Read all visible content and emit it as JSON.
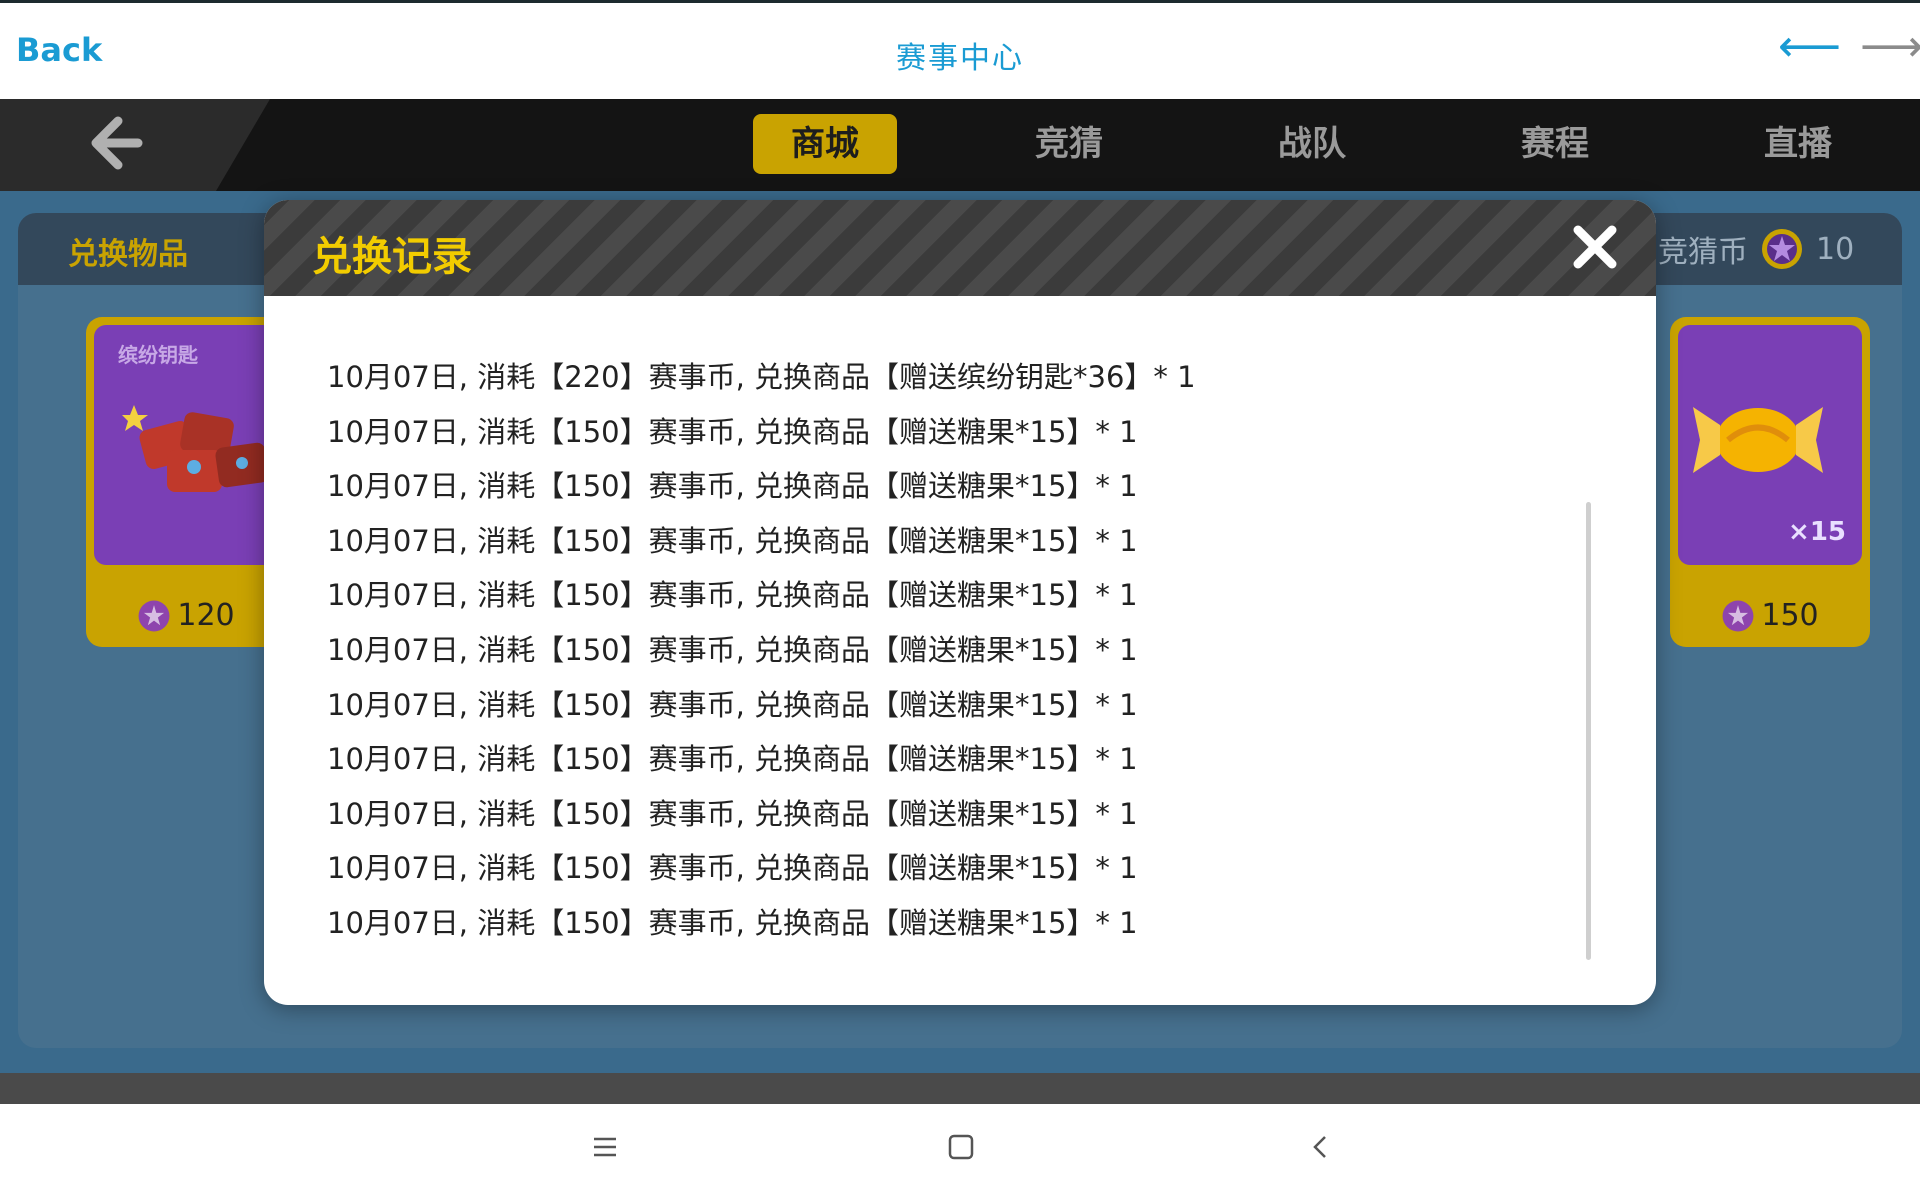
{
  "browser": {
    "back_label": "Back",
    "title": "赛事中心",
    "nav_back_glyph": "⟵",
    "nav_forward_glyph": "⟶"
  },
  "game_nav": {
    "tabs": [
      {
        "label": "商城",
        "active": true
      },
      {
        "label": "竞猜",
        "active": false
      },
      {
        "label": "战队",
        "active": false
      },
      {
        "label": "赛程",
        "active": false
      },
      {
        "label": "直播",
        "active": false
      }
    ]
  },
  "shop": {
    "header_label": "兑换物品",
    "coin_label": "竞猜币",
    "coin_value": "10",
    "cards": [
      {
        "label": "缤纷钥匙",
        "price": "120",
        "qty": ""
      },
      {
        "label": "",
        "price": "150",
        "qty": "×15"
      }
    ]
  },
  "modal": {
    "title": "兑换记录",
    "records": [
      "10月07日, 消耗【220】赛事币, 兑换商品【赠送缤纷钥匙*36】* 1",
      "10月07日, 消耗【150】赛事币, 兑换商品【赠送糖果*15】* 1",
      "10月07日, 消耗【150】赛事币, 兑换商品【赠送糖果*15】* 1",
      "10月07日, 消耗【150】赛事币, 兑换商品【赠送糖果*15】* 1",
      "10月07日, 消耗【150】赛事币, 兑换商品【赠送糖果*15】* 1",
      "10月07日, 消耗【150】赛事币, 兑换商品【赠送糖果*15】* 1",
      "10月07日, 消耗【150】赛事币, 兑换商品【赠送糖果*15】* 1",
      "10月07日, 消耗【150】赛事币, 兑换商品【赠送糖果*15】* 1",
      "10月07日, 消耗【150】赛事币, 兑换商品【赠送糖果*15】* 1",
      "10月07日, 消耗【150】赛事币, 兑换商品【赠送糖果*15】* 1",
      "10月07日, 消耗【150】赛事币, 兑换商品【赠送糖果*15】* 1"
    ]
  },
  "colors": {
    "accent": "#1a9bd3",
    "gold": "#c9a301",
    "modal_title": "#f2cc00"
  },
  "icons": {
    "game_back": "arrow-left-icon",
    "close": "close-icon",
    "coin": "coin-star-icon",
    "sys_menu": "menu-icon",
    "sys_home": "square-home-icon",
    "sys_back": "chevron-left-icon"
  }
}
